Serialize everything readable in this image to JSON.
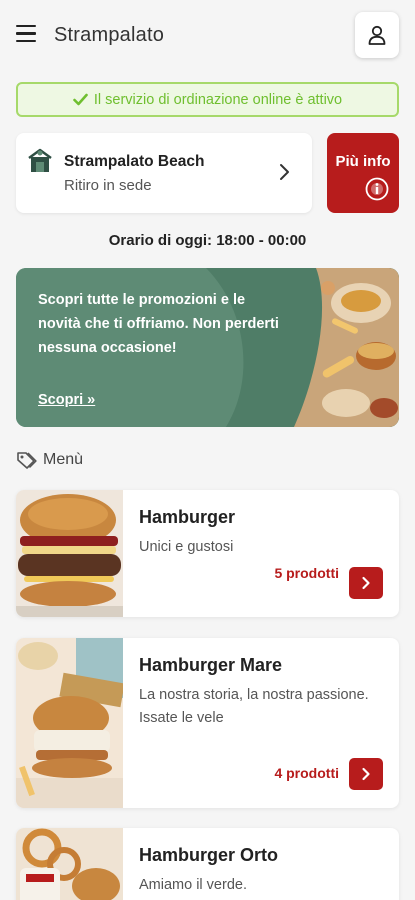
{
  "header": {
    "title": "Strampalato",
    "menu_icon": "hamburger-menu-icon",
    "user_icon": "user-icon"
  },
  "status": {
    "text": "Il servizio di ordinazione online è attivo",
    "color": "#6fbf2f"
  },
  "store": {
    "name": "Strampalato Beach",
    "mode": "Ritiro in sede",
    "info_label": "Più info"
  },
  "hours": {
    "text": "Orario di oggi: 18:00 - 00:00"
  },
  "promo": {
    "text": "Scopri tutte le promozioni e le novità che ti offriamo. Non perderti nessuna occasione!",
    "link": "Scopri »"
  },
  "menu": {
    "section_label": "Menù",
    "items": [
      {
        "title": "Hamburger",
        "description": "Unici e gustosi",
        "count": "5 prodotti"
      },
      {
        "title": "Hamburger Mare",
        "description": "La nostra storia, la nostra passione.\nIssate le vele",
        "count": "4 prodotti"
      },
      {
        "title": "Hamburger Orto",
        "description": "Amiamo il verde.",
        "count": ""
      }
    ]
  },
  "colors": {
    "accent": "#b71c1c",
    "promo_bg": "#5e8b75"
  }
}
